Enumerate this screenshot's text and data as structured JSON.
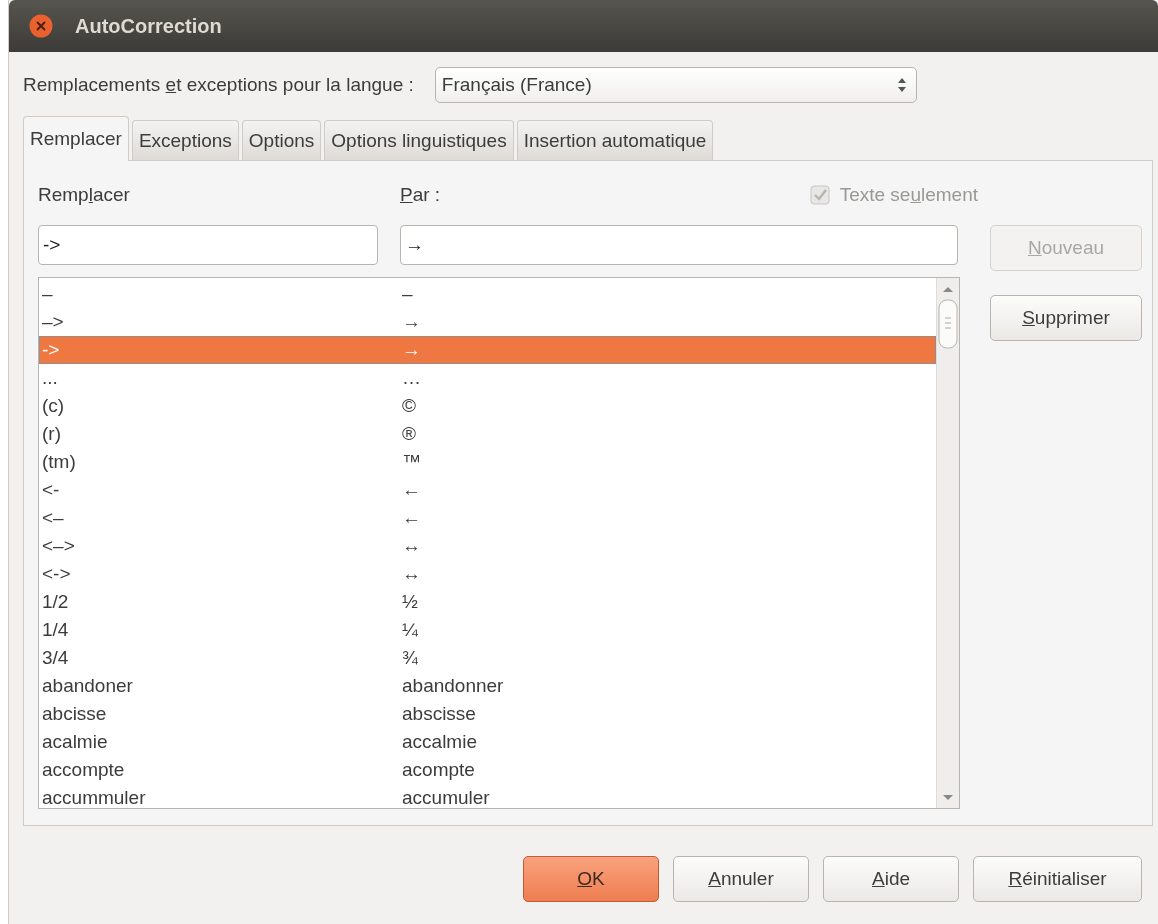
{
  "window": {
    "title": "AutoCorrection"
  },
  "language": {
    "label": {
      "before": "Remplacements ",
      "key": "e",
      "after": "t exceptions pour la langue :"
    },
    "value": "Français (France)"
  },
  "tabs": [
    {
      "label": "Remplacer",
      "selected": true
    },
    {
      "label": "Exceptions",
      "selected": false
    },
    {
      "label": "Options",
      "selected": false
    },
    {
      "label": "Options linguistiques",
      "selected": false
    },
    {
      "label": "Insertion automatique",
      "selected": false
    }
  ],
  "replace": {
    "column_1": {
      "label": {
        "before": "Remp",
        "key": "l",
        "after": "acer"
      }
    },
    "column_2": {
      "label": {
        "key": "P",
        "after": "ar :"
      }
    },
    "text_only": {
      "label": {
        "before": "Texte se",
        "key": "u",
        "after": "lement"
      },
      "checked": true,
      "disabled": true
    },
    "replace_value": "->",
    "with_value": "→",
    "rows": [
      {
        "from": "–",
        "to": "–",
        "selected": false
      },
      {
        "from": "–>",
        "to": "→",
        "selected": false
      },
      {
        "from": "->",
        "to": "→",
        "selected": true
      },
      {
        "from": "...",
        "to": "…",
        "selected": false
      },
      {
        "from": "(c)",
        "to": "©",
        "selected": false
      },
      {
        "from": "(r)",
        "to": "®",
        "selected": false
      },
      {
        "from": "(tm)",
        "to": "™",
        "selected": false
      },
      {
        "from": "<-",
        "to": "←",
        "selected": false
      },
      {
        "from": "<–",
        "to": "←",
        "selected": false
      },
      {
        "from": "<–>",
        "to": "↔",
        "selected": false
      },
      {
        "from": "<->",
        "to": "↔",
        "selected": false
      },
      {
        "from": "1/2",
        "to": "½",
        "selected": false
      },
      {
        "from": "1/4",
        "to": "¼",
        "selected": false
      },
      {
        "from": "3/4",
        "to": "¾",
        "selected": false
      },
      {
        "from": "abandoner",
        "to": "abandonner",
        "selected": false
      },
      {
        "from": "abcisse",
        "to": "abscisse",
        "selected": false
      },
      {
        "from": "acalmie",
        "to": "accalmie",
        "selected": false
      },
      {
        "from": "accompte",
        "to": "acompte",
        "selected": false
      },
      {
        "from": "accummuler",
        "to": "accumuler",
        "selected": false
      }
    ],
    "side_buttons": [
      {
        "label": {
          "key": "N",
          "after": "ouveau"
        },
        "disabled": true
      },
      {
        "label": {
          "key": "S",
          "after": "upprimer"
        },
        "disabled": false
      }
    ]
  },
  "buttons": [
    {
      "label": {
        "key": "O",
        "after": "K"
      },
      "default": true
    },
    {
      "label": {
        "key": "A",
        "after": "nnuler"
      },
      "default": false
    },
    {
      "label": {
        "key": "A",
        "after": "ide"
      },
      "default": false
    },
    {
      "label": {
        "key": "R",
        "after": "éinitialiser"
      },
      "default": false
    }
  ]
}
